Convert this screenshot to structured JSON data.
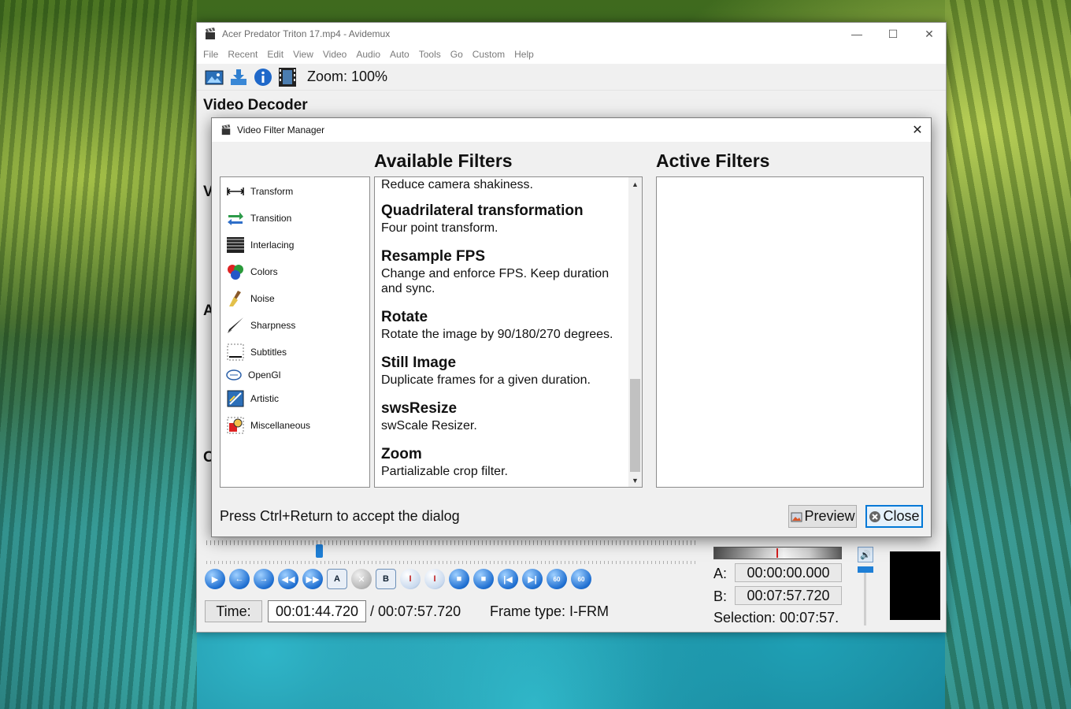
{
  "main_window": {
    "title": "Acer Predator Triton 17.mp4 - Avidemux",
    "menu": [
      "File",
      "Recent",
      "Edit",
      "View",
      "Video",
      "Audio",
      "Auto",
      "Tools",
      "Go",
      "Custom",
      "Help"
    ],
    "zoom_label": "Zoom: 100%",
    "section_title": "Video Decoder",
    "side_letters": [
      "V",
      "A",
      "O"
    ],
    "time_button": "Time:",
    "time_value": "00:01:44.720",
    "total_time": "/ 00:07:57.720",
    "frame_type": "Frame type: I-FRM",
    "marker_a_label": "A:",
    "marker_a": "00:00:00.000",
    "marker_b_label": "B:",
    "marker_b": "00:07:57.720",
    "selection": "Selection: 00:07:57.",
    "nav_buttons": [
      "A",
      "B",
      "60",
      "60"
    ],
    "progress_fraction": 0.219
  },
  "dialog": {
    "title": "Video Filter Manager",
    "available_header": "Available Filters",
    "active_header": "Active Filters",
    "categories": [
      {
        "label": "Transform",
        "icon": "transform-icon"
      },
      {
        "label": "Transition",
        "icon": "transition-icon"
      },
      {
        "label": "Interlacing",
        "icon": "interlacing-icon"
      },
      {
        "label": "Colors",
        "icon": "colors-icon"
      },
      {
        "label": "Noise",
        "icon": "noise-icon"
      },
      {
        "label": "Sharpness",
        "icon": "sharpness-icon"
      },
      {
        "label": "Subtitles",
        "icon": "subtitles-icon"
      },
      {
        "label": "OpenGl",
        "icon": "opengl-icon"
      },
      {
        "label": "Artistic",
        "icon": "artistic-icon"
      },
      {
        "label": "Miscellaneous",
        "icon": "miscellaneous-icon"
      }
    ],
    "top_partial_desc": "Reduce camera shakiness.",
    "filters": [
      {
        "name": "Quadrilateral transformation",
        "desc": "Four point transform."
      },
      {
        "name": "Resample FPS",
        "desc": "Change and enforce FPS. Keep duration and sync."
      },
      {
        "name": "Rotate",
        "desc": "Rotate the image by 90/180/270 degrees."
      },
      {
        "name": "Still Image",
        "desc": "Duplicate frames for a given duration."
      },
      {
        "name": "swsResize",
        "desc": "swScale Resizer."
      },
      {
        "name": "Zoom",
        "desc": "Partializable crop filter."
      }
    ],
    "hint": "Press Ctrl+Return to accept the dialog",
    "preview_label": "Preview",
    "close_label": "Close"
  },
  "colors": {
    "accent": "#0078d7",
    "slider": "#1e7fd6"
  }
}
